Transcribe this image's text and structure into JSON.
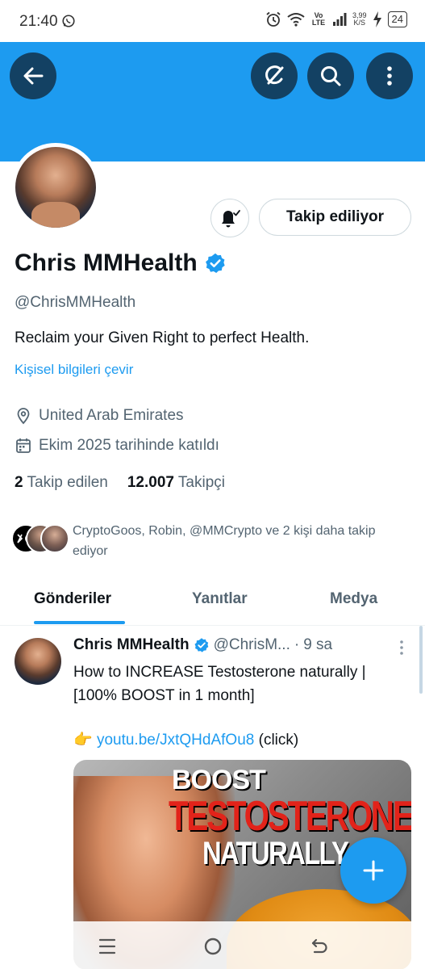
{
  "status_bar": {
    "time": "21:40",
    "network": "Vo LTE",
    "speed_value": "3,99",
    "speed_unit": "K/S",
    "battery": "24"
  },
  "profile": {
    "name": "Chris MMHealth",
    "handle": "@ChrisMMHealth",
    "bio": "Reclaim your Given Right to perfect Health.",
    "translate_label": "Kişisel bilgileri çevir",
    "location": "United Arab Emirates",
    "joined": "Ekim 2025 tarihinde katıldı",
    "following_count": "2",
    "following_label": "Takip edilen",
    "followers_count": "12.007",
    "followers_label": "Takipçi",
    "follow_button_label": "Takip ediliyor",
    "followed_by_text": "CryptoGoos, Robin, @MMCrypto ve 2 kişi daha takip ediyor",
    "verified": true,
    "accent_color": "#1d9bf0"
  },
  "tabs": [
    {
      "label": "Gönderiler",
      "active": true
    },
    {
      "label": "Yanıtlar",
      "active": false
    },
    {
      "label": "Medya",
      "active": false
    }
  ],
  "tweet": {
    "author_name": "Chris MMHealth",
    "author_handle": "@ChrisM...",
    "separator": "·",
    "time": "9 sa",
    "text": "How to INCREASE Testosterone naturally | [100% BOOST in 1 month]",
    "link_emoji": "👉",
    "link_text": "youtu.be/JxtQHdAfOu8",
    "link_suffix": "(click)",
    "media_line1": "BOOST",
    "media_line2": "TESTOSTERONE",
    "media_line3": "NATURALLY"
  },
  "icons": {
    "back": "arrow-left-icon",
    "grok": "grok-icon",
    "search": "search-icon",
    "more": "more-vertical-icon",
    "notifications": "bell-icon",
    "location": "location-pin-icon",
    "calendar": "calendar-icon",
    "compose": "plus-icon"
  }
}
